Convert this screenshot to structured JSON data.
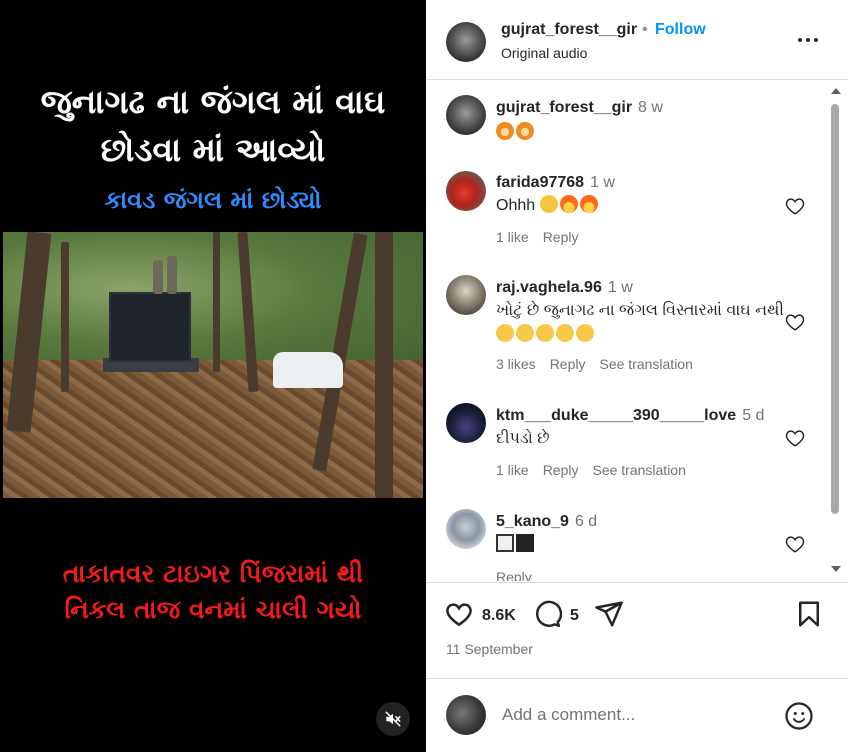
{
  "video": {
    "headline_line1": "જુનાગઢ ના જંગલ માં વાઘ",
    "headline_line2": "છોડવા માં આવ્યો",
    "subheadline": "કાવડ જંગલ માં છોડ્યો",
    "bottom_line1": "તાકાતવર  ટાઇગર  પિંજરામાં થી",
    "bottom_line2": "નિકલ તાજ  વનમાં ચાલી ગયો",
    "mute_icon": "speaker-muted-icon",
    "colors": {
      "headline": "#ffffff",
      "subheadline": "#2f8cff",
      "bottom": "#f21b1b"
    }
  },
  "header": {
    "username": "gujrat_forest__gir",
    "separator": "•",
    "follow_label": "Follow",
    "audio_label": "Original audio",
    "more_icon": "more-horizontal-icon"
  },
  "comments": [
    {
      "username": "gujrat_forest__gir",
      "time": "8 w",
      "text": "🦁🦁",
      "emoji": [
        "tiger-face",
        "tiger-face"
      ],
      "likes": "",
      "reply": "",
      "translation": ""
    },
    {
      "username": "farida97768",
      "time": "1 w",
      "text": "Ohhh",
      "emoji": [
        "clapping-hands",
        "fire",
        "fire"
      ],
      "likes": "1 like",
      "reply": "Reply",
      "translation": ""
    },
    {
      "username": "raj.vaghela.96",
      "time": "1 w",
      "text": "ખોટું છે જુનાગઢ ના જંગલ વિસ્તારમાં વાઘ નથી",
      "emoji": [
        "laughing",
        "laughing",
        "laughing",
        "laughing",
        "laughing"
      ],
      "likes": "3 likes",
      "reply": "Reply",
      "translation": "See translation"
    },
    {
      "username": "ktm___duke_____390_____love",
      "time": "5 d",
      "text": "દીપડો છે",
      "emoji": [],
      "likes": "1 like",
      "reply": "Reply",
      "translation": "See translation"
    },
    {
      "username": "5_kano_9",
      "time": "6 d",
      "text": "",
      "emoji": [
        "white-square",
        "black-square"
      ],
      "likes": "",
      "reply": "Reply",
      "translation": ""
    }
  ],
  "actions": {
    "like_count": "8.6K",
    "comment_count": "5",
    "date": "11 September"
  },
  "add_comment": {
    "placeholder": "Add a comment..."
  }
}
